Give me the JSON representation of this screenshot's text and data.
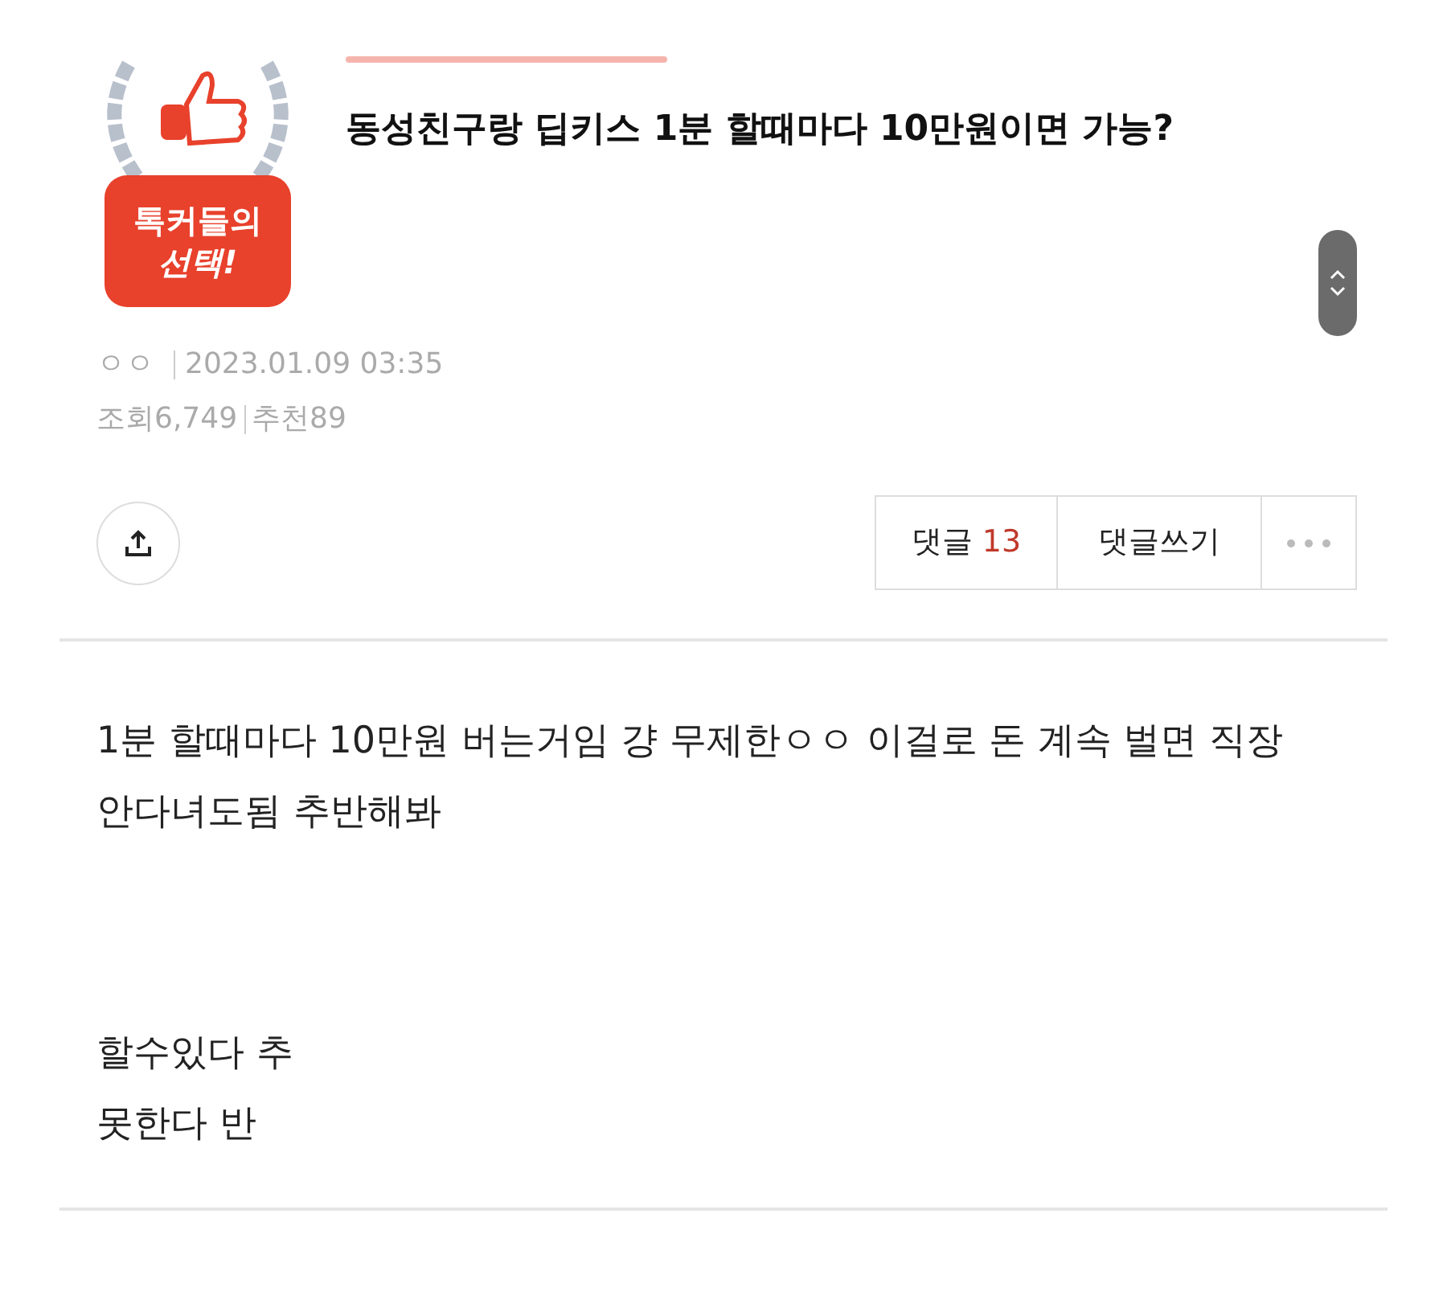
{
  "badge": {
    "label": "톡커들의",
    "label2": "선택!"
  },
  "title": "동성친구랑 딥키스 1분 할때마다 10만원이면 가능?",
  "meta": {
    "author": "ㅇㅇ",
    "date": "2023.01.09 03:35",
    "views_label": "조회",
    "views": "6,749",
    "likes_label": "추천",
    "likes": "89"
  },
  "actions": {
    "comments_label": "댓글",
    "comments_count": "13",
    "write_comment": "댓글쓰기"
  },
  "body": {
    "paragraphs": [
      [
        "1분 할때마다 10만원 버는거임 걍 무제한ㅇㅇ 이걸로 돈 계속 벌면 직장 안다녀도됨 추반해봐"
      ],
      [
        "할수있다 추",
        "못한다 반"
      ]
    ]
  }
}
